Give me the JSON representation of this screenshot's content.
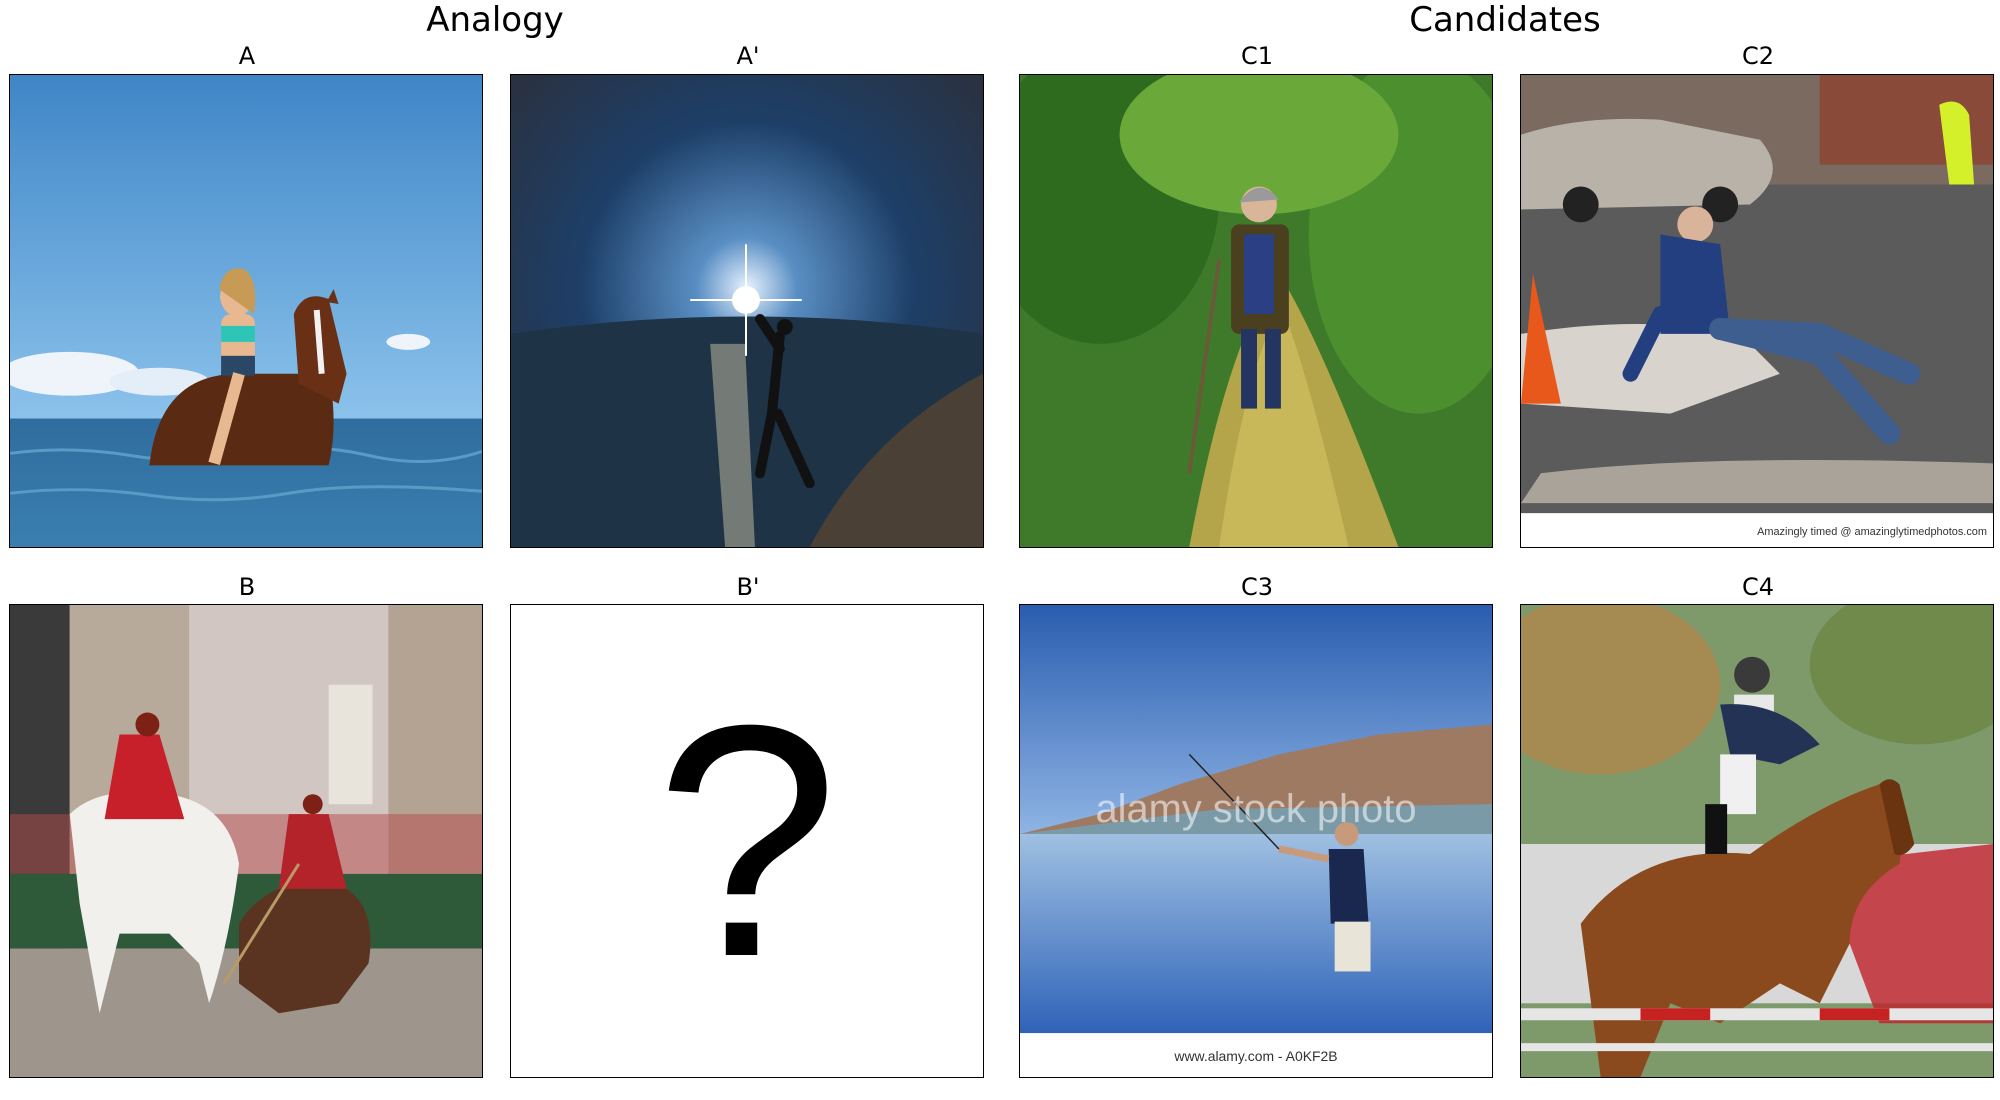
{
  "headers": {
    "analogy": "Analogy",
    "candidates": "Candidates"
  },
  "panels": {
    "A": {
      "label": "A"
    },
    "A_prime": {
      "label": "A'"
    },
    "B": {
      "label": "B"
    },
    "B_prime": {
      "label": "B'",
      "placeholder": "?"
    },
    "C1": {
      "label": "C1"
    },
    "C2": {
      "label": "C2",
      "credit": "Amazingly timed @ amazinglytimedphotos.com"
    },
    "C3": {
      "label": "C3",
      "watermark": "alamy stock photo",
      "credit": "www.alamy.com - A0KF2B"
    },
    "C4": {
      "label": "C4"
    }
  }
}
